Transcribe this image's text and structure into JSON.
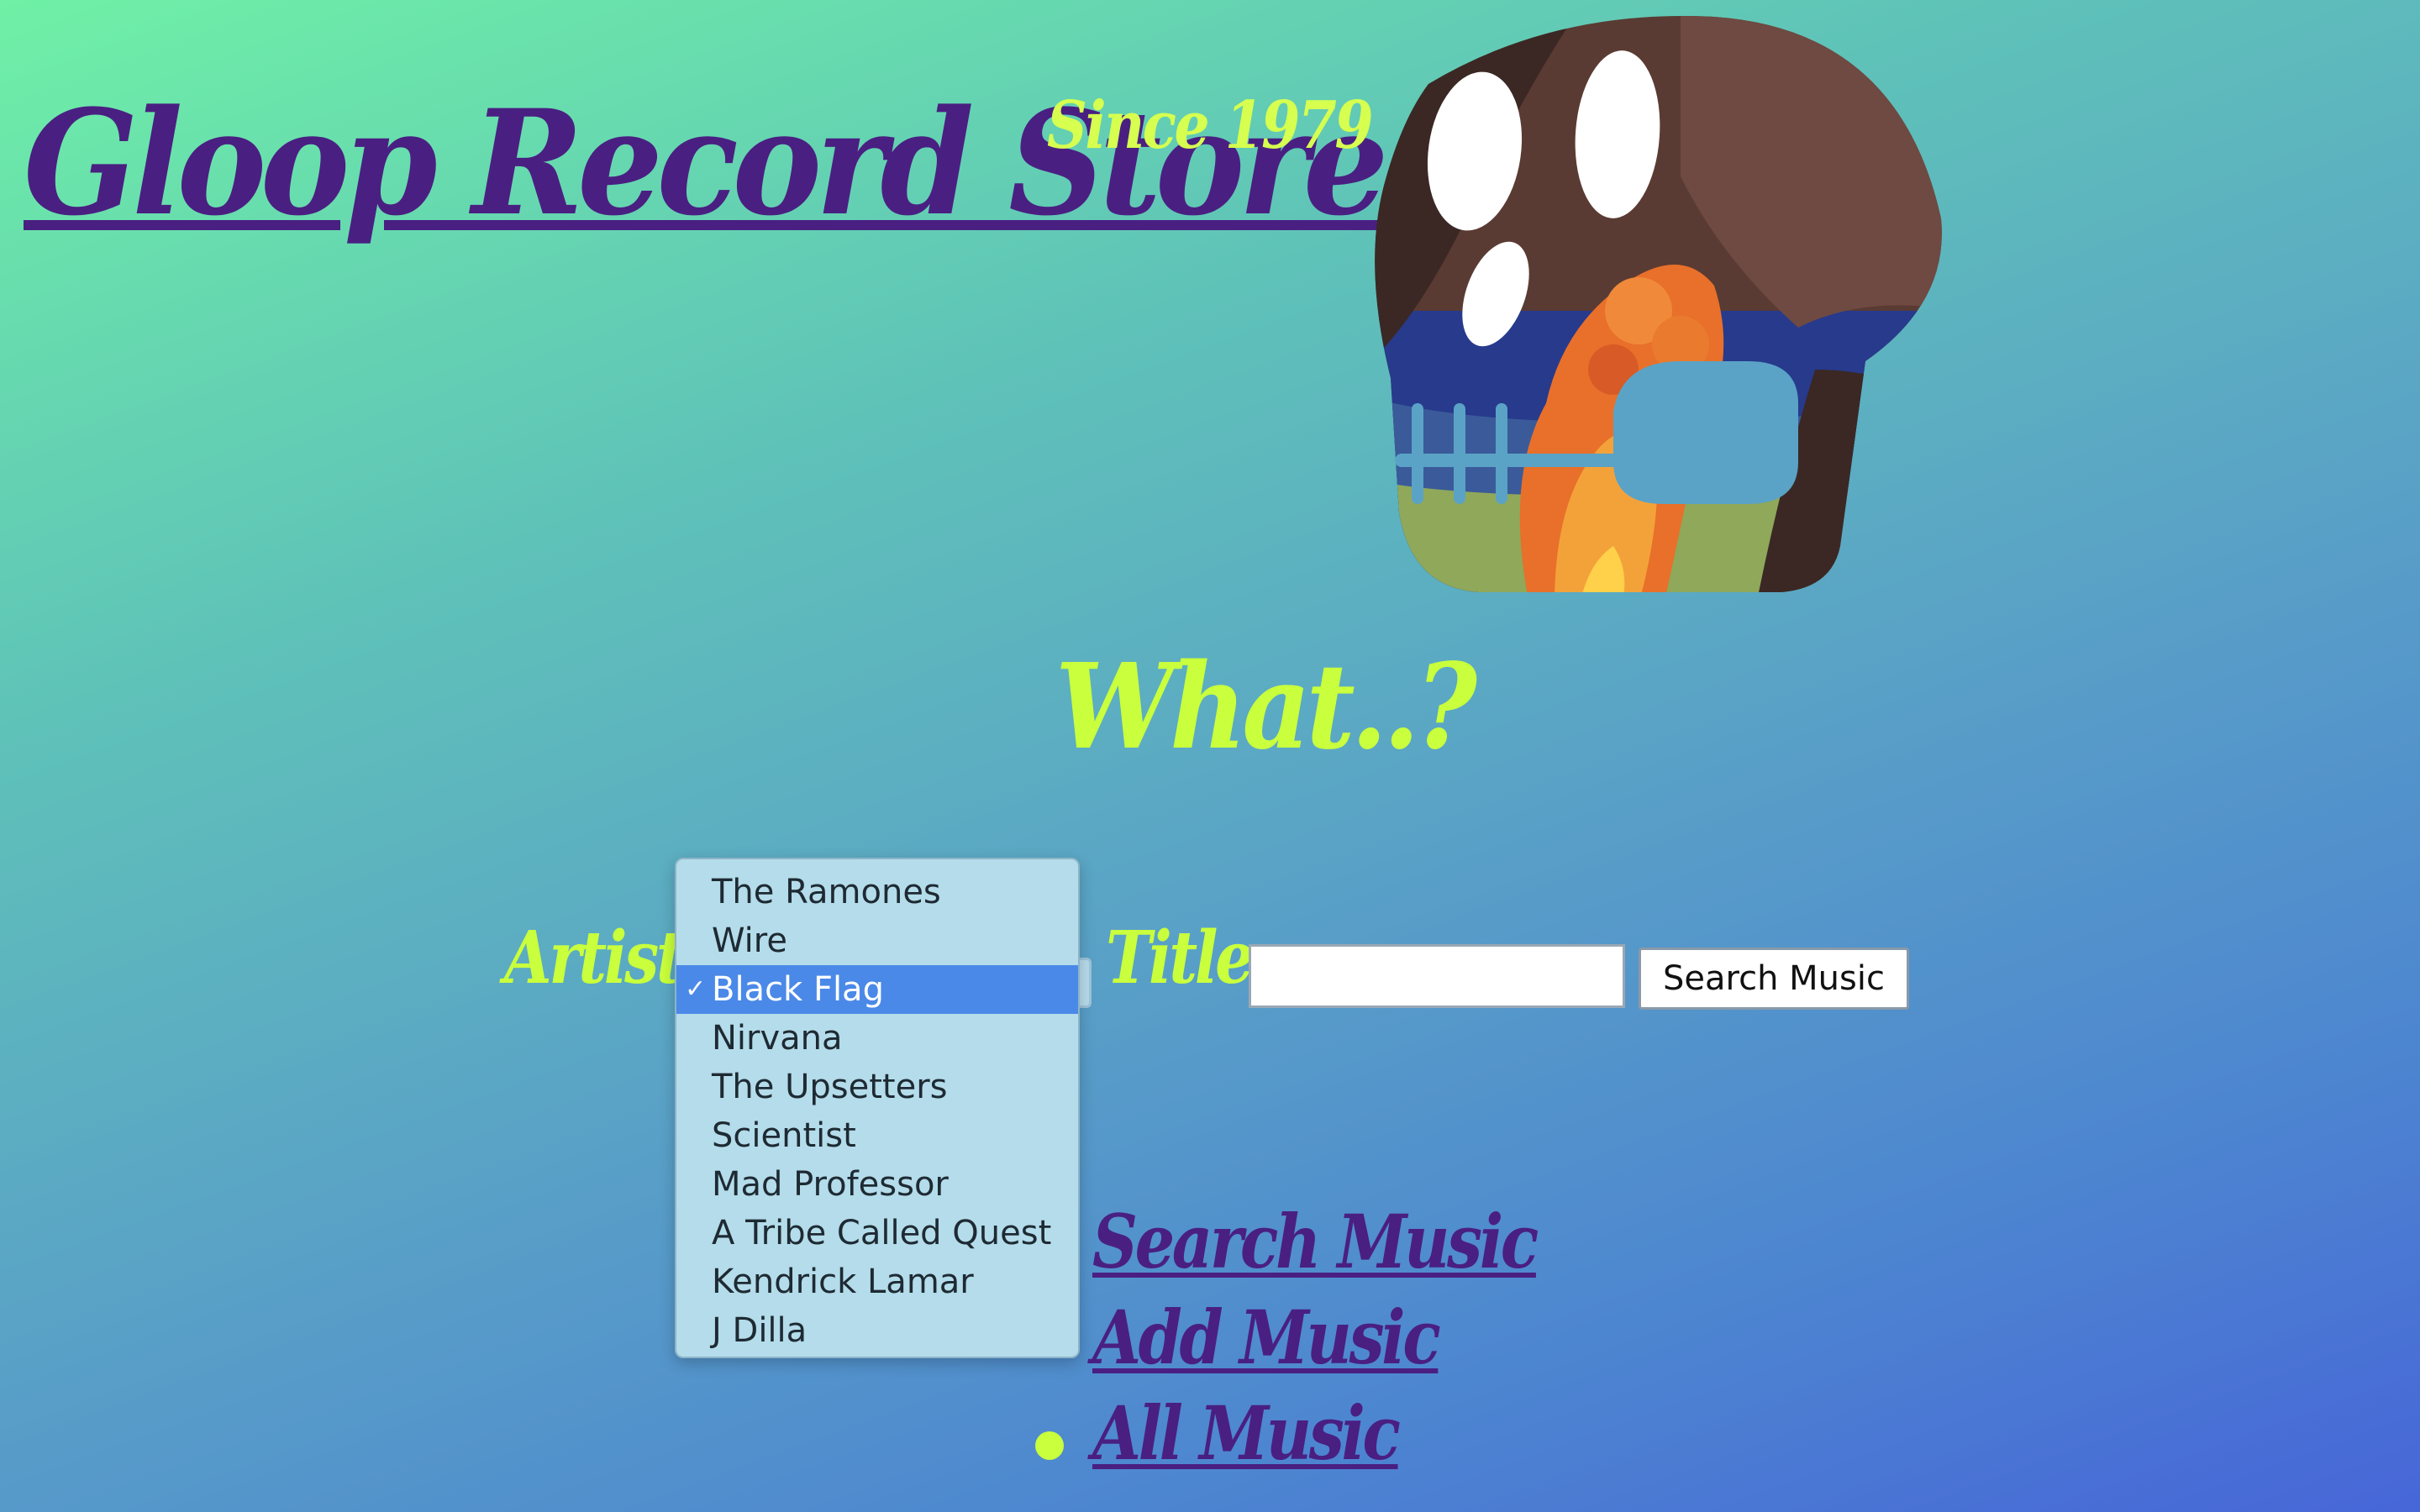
{
  "header": {
    "title": "Gloop Record Store",
    "tagline": "Since 1979"
  },
  "hero": {
    "image": "skull-illustration"
  },
  "heading": "What..?",
  "search_form": {
    "artist_label": "Artist:",
    "title_label": "Title:",
    "title_value": "",
    "artist_selected": "Black Flag",
    "artist_options": [
      "The Ramones",
      "Wire",
      "Black Flag",
      "Nirvana",
      "The Upsetters",
      "Scientist",
      "Mad Professor",
      "A Tribe Called Quest",
      "Kendrick Lamar",
      "J Dilla"
    ],
    "check_mark": "✓",
    "submit_label": "Search Music"
  },
  "nav": {
    "items": [
      {
        "label": "Search Music",
        "active": false
      },
      {
        "label": "Add Music",
        "active": false
      },
      {
        "label": "All Music",
        "active": true
      }
    ]
  },
  "colors": {
    "title": "#4a1f82",
    "accent": "#c9ff3c",
    "selected_option": "#4a89e8"
  }
}
